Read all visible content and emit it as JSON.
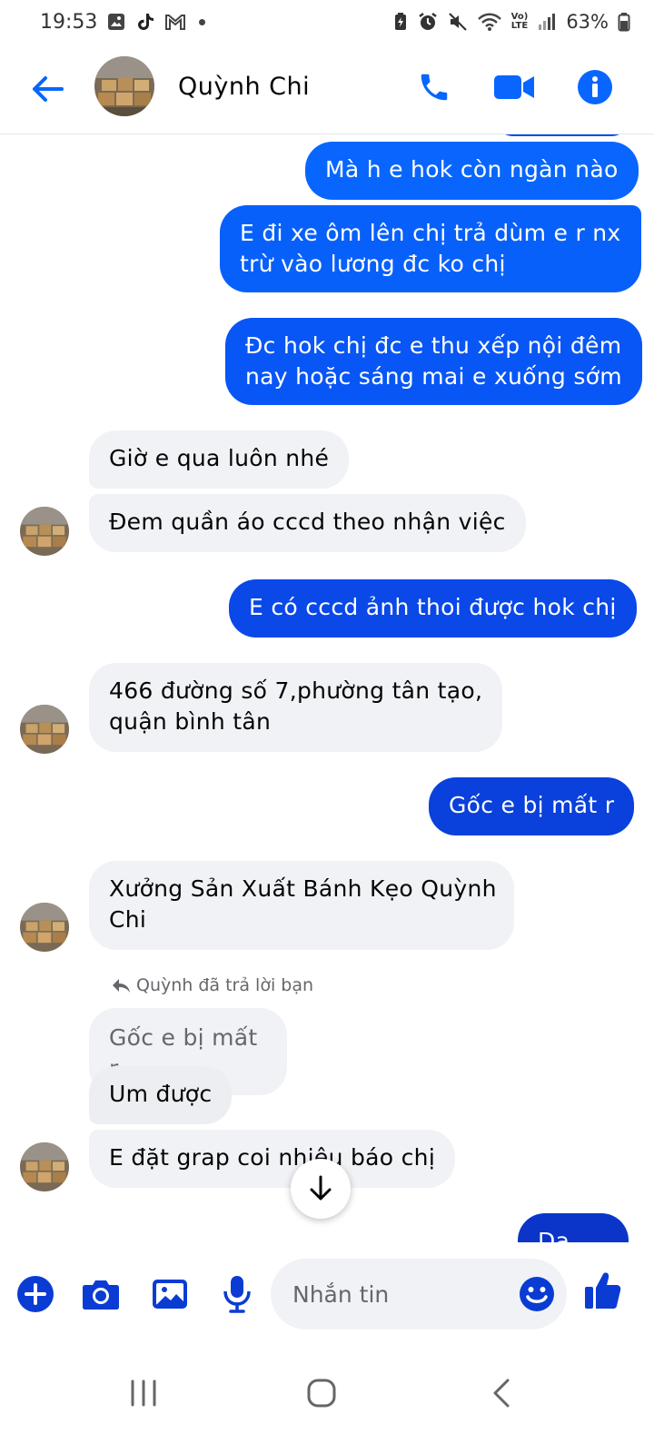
{
  "status_bar": {
    "time": "19:53",
    "battery": "63%",
    "network_top": "Vo)",
    "network_bottom": "LTE"
  },
  "header": {
    "contact_name": "Quỳnh Chi"
  },
  "colors": {
    "accent": "#0866ff",
    "bubble_dark": "#0a3cd4",
    "incoming_bg": "#f0f2f5"
  },
  "messages": [
    {
      "text": "Mà h e hok còn ngàn nào",
      "direction": "out"
    },
    {
      "text": "E đi xe ôm lên chị trả dùm e r nx\ntrừ vào lương đc ko chị",
      "direction": "out"
    },
    {
      "text": "Đc hok chị đc e thu xếp nội đêm\nnay hoặc sáng mai e xuống sớm",
      "direction": "out"
    },
    {
      "text": "Giờ e qua luôn nhé",
      "direction": "in"
    },
    {
      "text": "Đem quần áo cccd theo nhận việc",
      "direction": "in"
    },
    {
      "text": "E có cccd ảnh thoi được hok chị",
      "direction": "out"
    },
    {
      "text": "466 đường số 7,phường tân tạo,\nquận bình tân",
      "direction": "in"
    },
    {
      "text": "Gốc e bị mất r",
      "direction": "out"
    },
    {
      "text": "Xưởng Sản Xuất Bánh Kẹo Quỳnh\nChi",
      "direction": "in"
    },
    {
      "text": "Gốc e bị mất r",
      "direction": "quoted"
    },
    {
      "text": "Um được",
      "direction": "in"
    },
    {
      "text": "E đặt grap coi nhiêu báo chị",
      "direction": "in"
    },
    {
      "text": "Dạ chị",
      "direction": "out"
    }
  ],
  "reply_note": "Quỳnh đã trả lời bạn",
  "composer": {
    "placeholder": "Nhắn tin"
  }
}
